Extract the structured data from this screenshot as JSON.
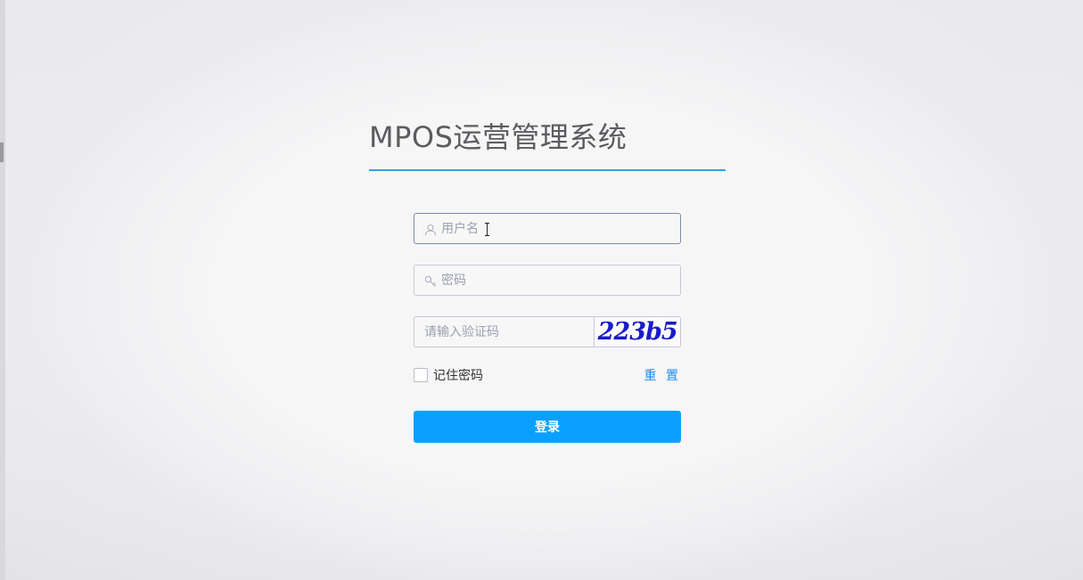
{
  "app": {
    "title": "MPOS运营管理系统"
  },
  "login_form": {
    "username": {
      "placeholder": "用户名",
      "value": "",
      "icon": "user-icon"
    },
    "password": {
      "placeholder": "密码",
      "value": "",
      "icon": "key-icon"
    },
    "captcha": {
      "placeholder": "请输入验证码",
      "value": "",
      "image_text": "223b5"
    },
    "remember_label": "记住密码",
    "remember_checked": false,
    "reset_label": "重 置",
    "submit_label": "登录"
  },
  "colors": {
    "accent": "#2ea3ee",
    "button": "#0aa0ff",
    "link": "#1a8cef",
    "captcha_text": "#1a1acb"
  }
}
